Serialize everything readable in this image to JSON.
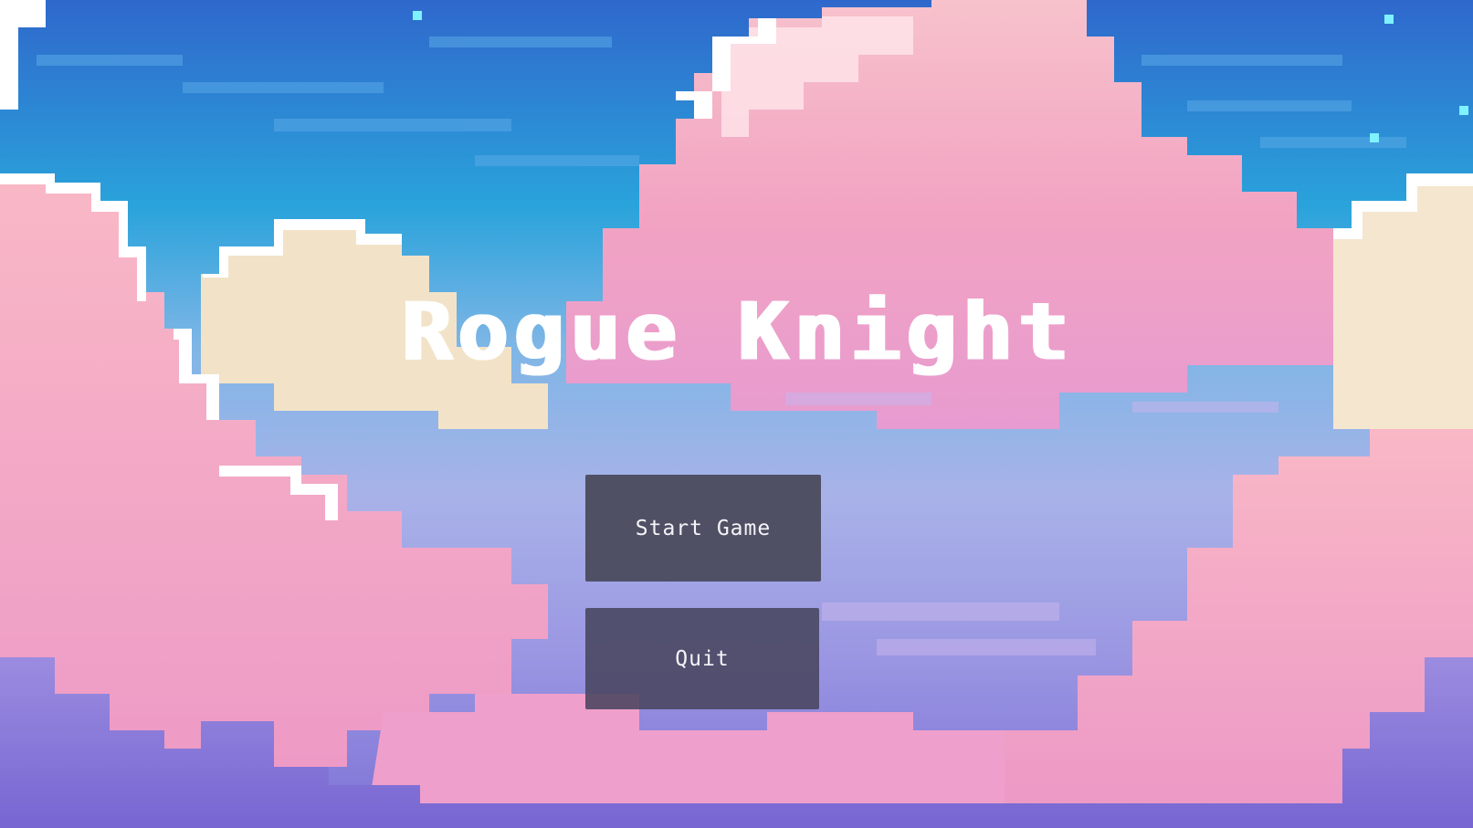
{
  "game": {
    "title": "Rogue Knight"
  },
  "menu": {
    "start_label": "Start Game",
    "quit_label": "Quit"
  },
  "colors": {
    "sky_top": "#2e6fcf",
    "sky_mid": "#27b7e0",
    "cloud_pink": "#f3a6c4",
    "cloud_cream": "#f2e6c4",
    "haze_lavender": "#a9b3e6",
    "ground_purple": "#7e74d8",
    "button_bg": "#4c4c60",
    "text_white": "#ffffff"
  }
}
